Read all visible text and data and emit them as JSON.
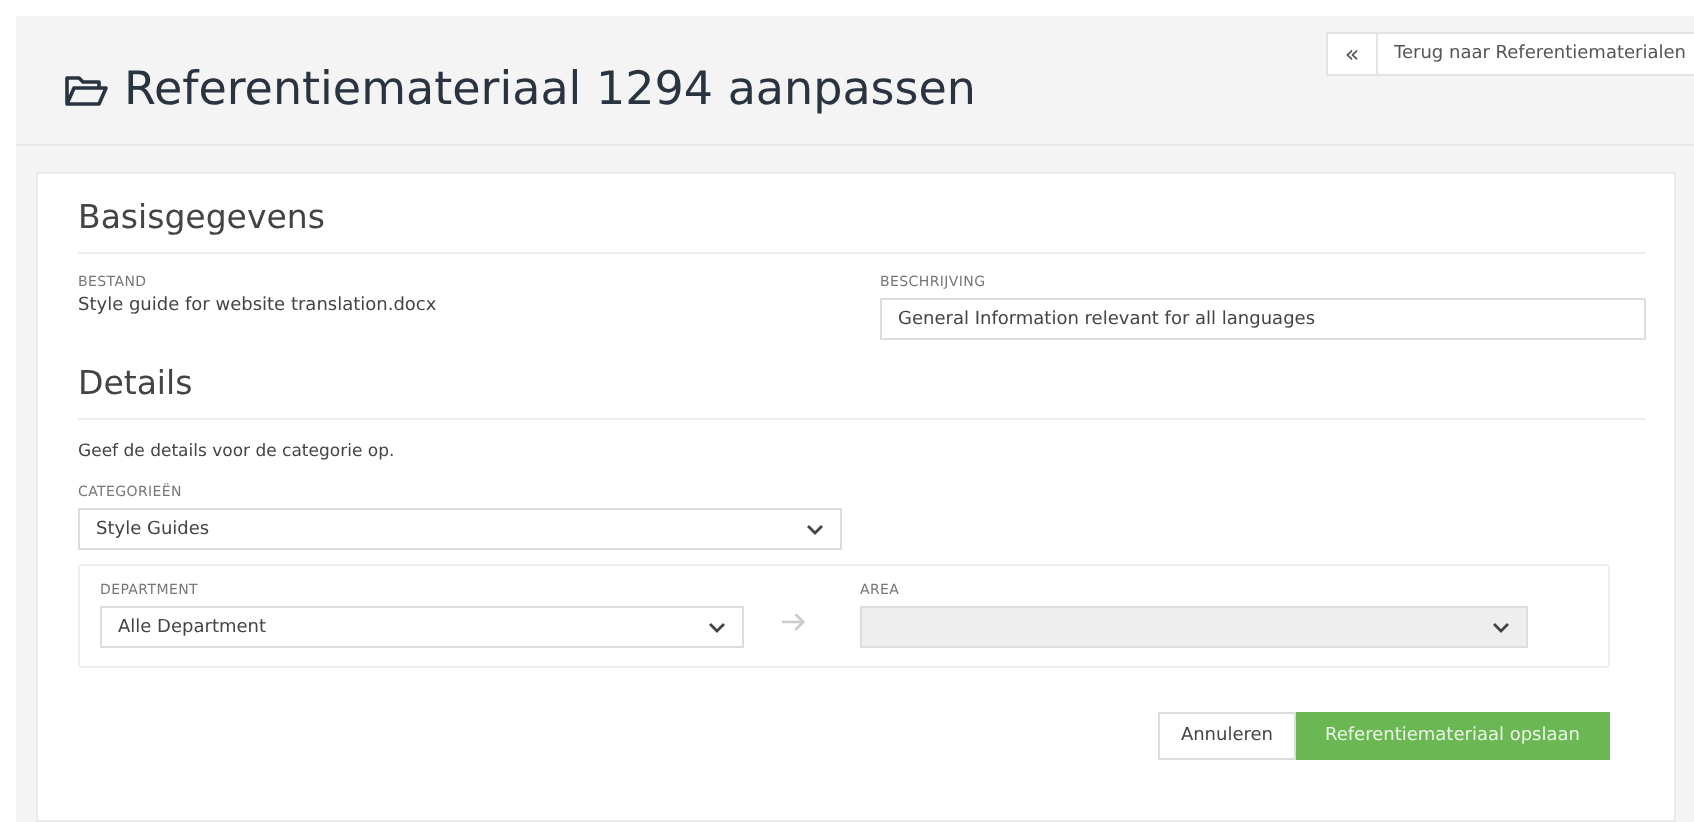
{
  "header": {
    "title": "Referentiemateriaal 1294 aanpassen",
    "back_icon": "«",
    "back_link": "Terug naar Referentiematerialen"
  },
  "basis": {
    "title": "Basisgegevens",
    "file_label": "BESTAND",
    "file_value": "Style guide for website translation.docx",
    "description_label": "BESCHRIJVING",
    "description_value": "General Information relevant for all languages"
  },
  "details": {
    "title": "Details",
    "intro": "Geef de details voor de categorie op.",
    "category_label": "CATEGORIEËN",
    "category_value": "Style Guides",
    "selects": [
      {
        "label": "DEPARTMENT",
        "value": "Alle Department",
        "disabled": false
      },
      {
        "label": "AREA",
        "disabled": true
      }
    ]
  },
  "buttons": [
    {
      "label": "Annuleren",
      "kind": "secondary"
    },
    {
      "label": "Referentiemateriaal opslaan",
      "kind": "primary"
    }
  ]
}
